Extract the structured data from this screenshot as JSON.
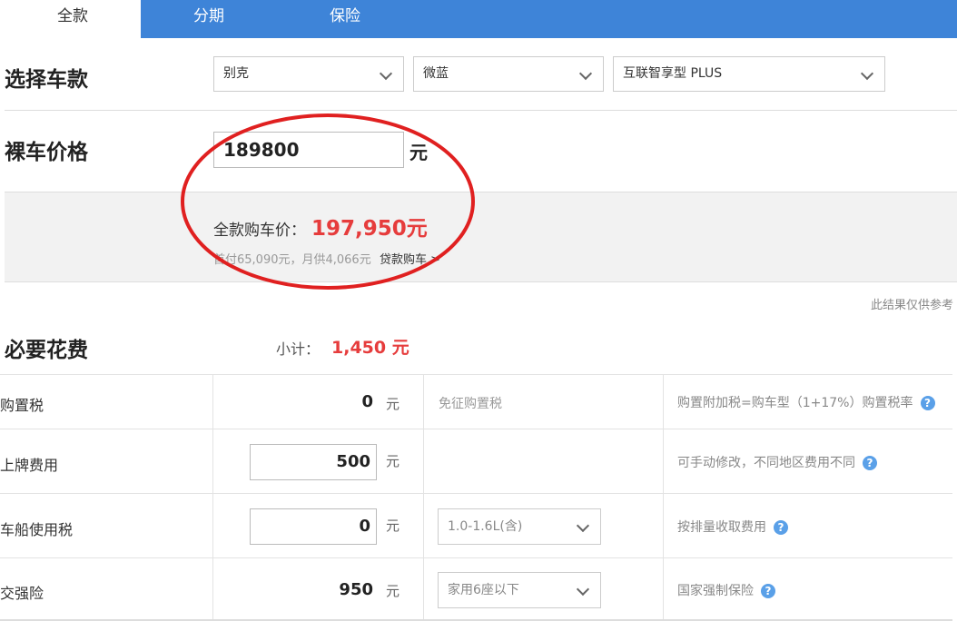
{
  "tabs": [
    "全款",
    "分期",
    "保险"
  ],
  "select_model": {
    "label": "选择车款",
    "brand": "别克",
    "series": "微蓝",
    "trim": "互联智享型 PLUS"
  },
  "bare_price": {
    "label": "裸车价格",
    "value": "189800",
    "unit": "元"
  },
  "result": {
    "total_label": "全款购车价：",
    "total_value": "197,950元",
    "sub_info": "首付65,090元，月供4,066元",
    "loan_link": "贷款购车 >"
  },
  "note": "此结果仅供参考",
  "required": {
    "label": "必要花费",
    "subtotal_label": "小计：",
    "subtotal_value": "1,450 元"
  },
  "rows": [
    {
      "label": "购置税",
      "value": "0",
      "unit": "元",
      "mid": "免征购置税",
      "right": "购置附加税=购车型（1+17%）购置税率"
    },
    {
      "label": "上牌费用",
      "value": "500",
      "unit": "元",
      "mid": "",
      "right": "可手动修改，不同地区费用不同"
    },
    {
      "label": "车船使用税",
      "value": "0",
      "unit": "元",
      "mid": "1.0-1.6L(含)",
      "right": "按排量收取费用"
    },
    {
      "label": "交强险",
      "value": "950",
      "unit": "元",
      "mid": "家用6座以下",
      "right": "国家强制保险"
    }
  ],
  "colors": {
    "tab_bar": "#3e84d8",
    "accent_red": "#e63c3c",
    "help_icon": "#5aa0e8",
    "annotation": "#e02020"
  },
  "icons": {
    "help": "question-circle-icon",
    "dropdown": "chevron-down-icon"
  }
}
